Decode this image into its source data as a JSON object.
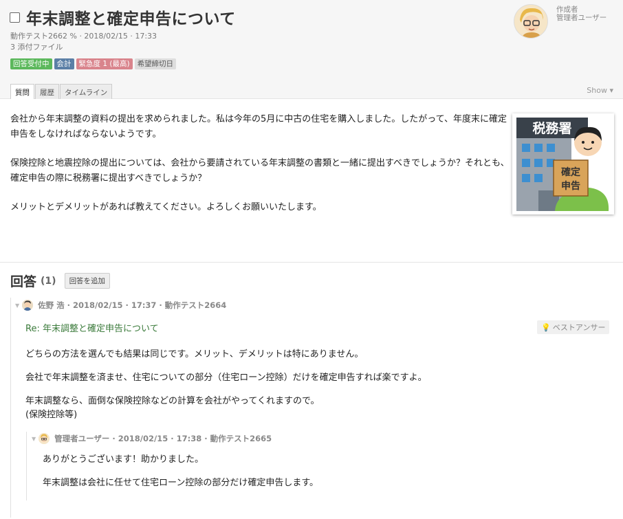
{
  "question": {
    "title": "年末調整と確定申告について",
    "meta": "動作テスト2662 % · 2018/02/15 · 17:33",
    "attachments": "3 添付ファイル",
    "tags": [
      "回答受付中",
      "会計",
      "緊急度 1 (最高)",
      "希望締切日"
    ],
    "author_label": "作成者",
    "author_name": "管理者ユーザー",
    "tabs": [
      "質問",
      "履歴",
      "タイムライン"
    ],
    "show_label": "Show",
    "body": [
      "会社から年末調整の資料の提出を求められました。私は今年の5月に中古の住宅を購入しました。したがって、年度末に確定申告をしなければならないようです。",
      "保険控除と地震控除の提出については、会社から要請されている年末調整の書類と一緒に提出すべきでしょうか？それとも、確定申告の際に税務署に提出すべきでしょうか？",
      "メリットとデメリットがあれば教えてください。よろしくお願いいたします。"
    ],
    "illustration": {
      "sign_text": "税務署",
      "paper_text_1": "確定",
      "paper_text_2": "申告"
    }
  },
  "answers": {
    "title": "回答",
    "count": "(1)",
    "add_button": "回答を追加",
    "items": [
      {
        "meta": "佐野 浩 · 2018/02/15 · 17:37 · 動作テスト2664",
        "re_title": "Re: 年末調整と確定申告について",
        "best_label": "ベストアンサー",
        "body": [
          "どちらの方法を選んでも結果は同じです。メリット、デメリットは特にありません。",
          "会社で年末調整を済ませ、住宅についての部分（住宅ローン控除）だけを確定申告すれば楽ですよ。",
          "年末調整なら、面倒な保険控除などの計算を会社がやってくれますので。",
          "(保険控除等)"
        ],
        "reply": {
          "meta": "管理者ユーザー · 2018/02/15 · 17:38 · 動作テスト2665",
          "body": [
            "ありがとうございます！助かりました。",
            "年末調整は会社に任せて住宅ローン控除の部分だけ確定申告します。"
          ]
        }
      }
    ]
  },
  "colors": {
    "tag_open": "#5cb85c",
    "tag_accounting": "#5b7fa6",
    "tag_urgency": "#d9848c",
    "re_title": "#3a7a3a"
  }
}
